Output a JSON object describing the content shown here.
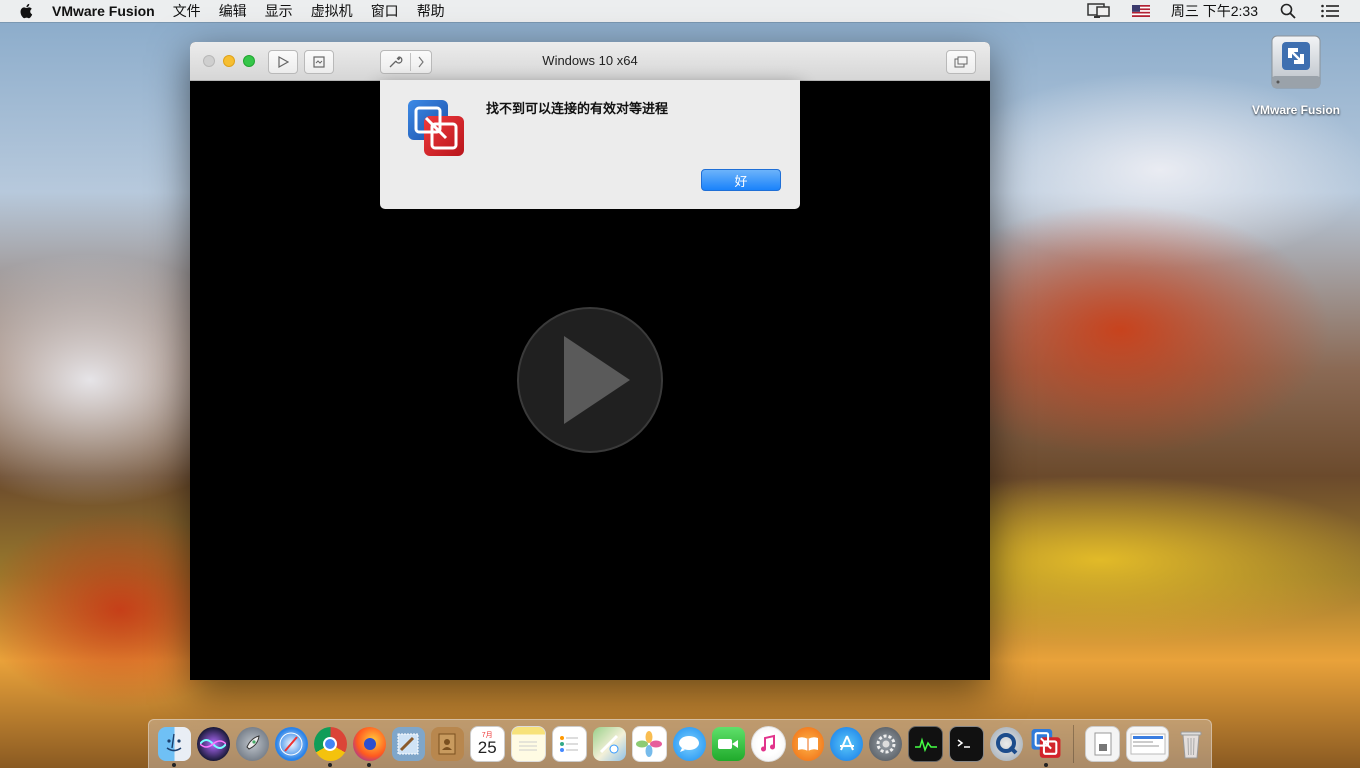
{
  "menubar": {
    "app_name": "VMware Fusion",
    "menus": [
      "文件",
      "编辑",
      "显示",
      "虚拟机",
      "窗口",
      "帮助"
    ],
    "clock": "周三 下午2:33"
  },
  "desktop": {
    "icon_label": "VMware Fusion"
  },
  "vm_window": {
    "title": "Windows 10 x64"
  },
  "dialog": {
    "message": "找不到可以连接的有效对等进程",
    "ok_label": "好"
  },
  "dock": {
    "calendar_month": "7月",
    "calendar_day": "25"
  },
  "colors": {
    "accent": "#1a82fb",
    "vmware_blue": "#1f63c5",
    "vmware_red": "#d2232a"
  }
}
